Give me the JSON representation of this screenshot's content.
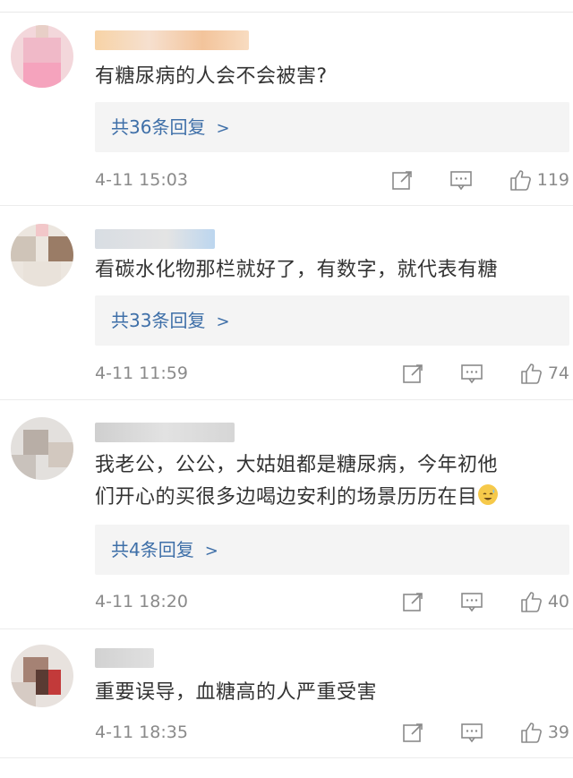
{
  "comments": [
    {
      "text": "有糖尿病的人会不会被害?",
      "replies_label": "共36条回复",
      "time": "4-11 15:03",
      "likes": "119",
      "username_colors": [
        "#f7d3a6",
        "#f6e0cf",
        "#f3c49b",
        "#f8dcc1"
      ]
    },
    {
      "text": "看碳水化物那栏就好了，有数字，就代表有糖",
      "replies_label": "共33条回复",
      "time": "4-11 11:59",
      "likes": "74",
      "username_colors": [
        "#d8dde3",
        "#e4e4e4",
        "#bcd6ef"
      ]
    },
    {
      "text_lines": [
        "我老公，公公，大姑姐都是糖尿病，今年初他",
        "们开心的买很多边喝边安利的场景历历在目"
      ],
      "replies_label": "共4条回复",
      "time": "4-11 18:20",
      "likes": "40",
      "username_colors": [
        "#cfcfcf",
        "#e2e2e2",
        "#d6d6d6"
      ]
    },
    {
      "text": "重要误导，血糖高的人严重受害",
      "time": "4-11 18:35",
      "likes": "39",
      "username_colors": [
        "#d2d2d2",
        "#e0e0e0"
      ]
    }
  ],
  "icons": {
    "repost": "share-icon",
    "comment": "comment-icon",
    "like": "thumbs-up-icon",
    "emoji": "sweat-smile-emoji-icon"
  },
  "colors": {
    "link": "#3e6fa8",
    "meta": "#8a8a8a",
    "reply_bg": "#f4f4f4"
  }
}
